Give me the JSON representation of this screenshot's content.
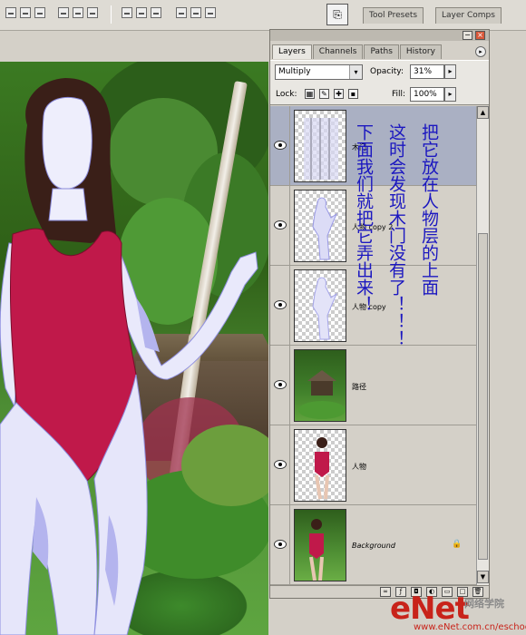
{
  "wells": {
    "tab1": "Tool Presets",
    "tab2": "Layer Comps"
  },
  "panel": {
    "tabs": [
      "Layers",
      "Channels",
      "Paths",
      "History"
    ],
    "blend_mode": "Multiply",
    "opacity_label": "Opacity:",
    "opacity_value": "31%",
    "lock_label": "Lock:",
    "fill_label": "Fill:",
    "fill_value": "100%",
    "layers": [
      {
        "name": "木门"
      },
      {
        "name": "人物 copy 2"
      },
      {
        "name": "人物 copy"
      },
      {
        "name": "路径"
      },
      {
        "name": "人物"
      },
      {
        "name": "Background"
      }
    ]
  },
  "overlay": {
    "col1": "把它放在人物层的上面",
    "col2": "这时会发现木门没有了！！！",
    "col3": "下面我们就把它弄出来！"
  },
  "watermark": {
    "big": "eNet",
    "cn": "网络学院",
    "url": "www.eNet.com.cn/eschool"
  },
  "colors": {
    "overlay_text": "#1c18c0",
    "selected_layer": "#aab0c3",
    "swimsuit": "#c0194a",
    "watermark": "#c8231a"
  }
}
